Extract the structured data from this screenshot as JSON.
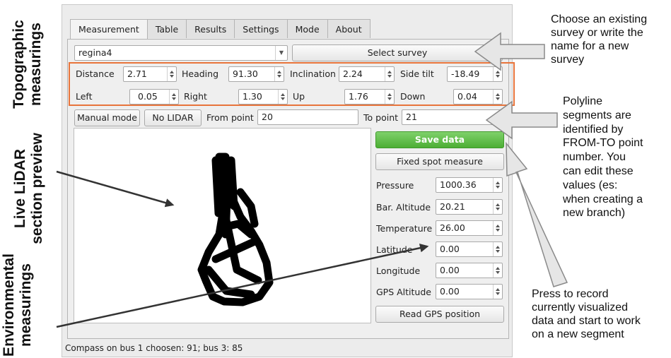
{
  "tabs": [
    "Measurement",
    "Table",
    "Results",
    "Settings",
    "Mode",
    "About"
  ],
  "survey": {
    "value": "regina4",
    "select_button": "Select survey"
  },
  "topo": {
    "distance_label": "Distance",
    "distance": "2.71",
    "heading_label": "Heading",
    "heading": "91.30",
    "inclination_label": "Inclination",
    "inclination": "2.24",
    "side_tilt_label": "Side tilt",
    "side_tilt": "-18.49",
    "left_label": "Left",
    "left": "0.05",
    "right_label": "Right",
    "right": "1.30",
    "up_label": "Up",
    "up": "1.76",
    "down_label": "Down",
    "down": "0.04"
  },
  "controls": {
    "manual_mode": "Manual mode",
    "no_lidar": "No LIDAR",
    "from_point_label": "From point",
    "from_point": "20",
    "to_point_label": "To point",
    "to_point": "21"
  },
  "side": {
    "save_data": "Save data",
    "fixed_spot": "Fixed spot measure",
    "pressure_label": "Pressure",
    "pressure": "1000.36",
    "bar_altitude_label": "Bar. Altitude",
    "bar_altitude": "20.21",
    "temperature_label": "Temperature",
    "temperature": "26.00",
    "latitude_label": "Latitude",
    "latitude": "0.00",
    "longitude_label": "Longitude",
    "longitude": "0.00",
    "gps_altitude_label": "GPS Altitude",
    "gps_altitude": "0.00",
    "read_gps": "Read GPS position"
  },
  "status_bar": "Compass on bus 1 choosen: 91; bus 3: 85",
  "annotations": {
    "topographic": [
      "Topographic",
      "measurings"
    ],
    "lidar": [
      "Live LiDAR",
      "section preview"
    ],
    "environmental": [
      "Environmental",
      "measurings"
    ],
    "choose_survey": [
      "Choose an existing",
      "survey or write the",
      "name for a new",
      "survey"
    ],
    "polyline": [
      "Polyline",
      "segments are",
      "identified by",
      "FROM-TO point",
      "number. You",
      "can edit these",
      "values (es:",
      "when creating a",
      "new branch)"
    ],
    "press_record": [
      "Press to record",
      "currently visualized",
      "data and start to work",
      "on a new segment"
    ]
  },
  "colors": {
    "highlight_box": "#e8743b",
    "save_button": "#4cae34",
    "arrow_fill": "#e6e6e6",
    "arrow_stroke": "#8a8a8a"
  }
}
